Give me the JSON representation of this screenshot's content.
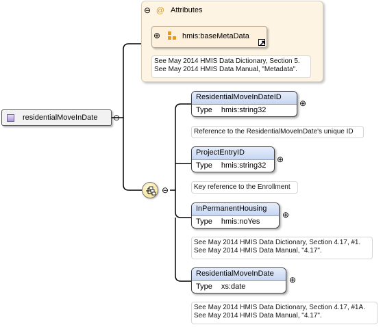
{
  "root": {
    "name": "residentialMoveInDate",
    "collapse_symbol": "⊖"
  },
  "attributes": {
    "title": "Attributes",
    "at_symbol": "@",
    "collapse_symbol": "⊖",
    "ref": {
      "name": "hmis:baseMetaData",
      "expand_symbol": "⊕"
    },
    "doc_lines": [
      "See May 2014 HMIS Data Dictionary, Section 5.",
      "See May 2014 HMIS Data Manual, \"Metadata\"."
    ]
  },
  "sequence": {
    "collapse_symbol": "⊖"
  },
  "elements": [
    {
      "name": "ResidentialMoveInDateID",
      "type_label": "Type",
      "type": "hmis:string32",
      "expand_symbol": "⊕",
      "doc": [
        "Reference to the ResidentialMoveInDate's unique ID"
      ]
    },
    {
      "name": "ProjectEntryID",
      "type_label": "Type",
      "type": "hmis:string32",
      "expand_symbol": "⊕",
      "doc": [
        "Key reference to the Enrollment"
      ]
    },
    {
      "name": "InPermanentHousing",
      "type_label": "Type",
      "type": "hmis:noYes",
      "expand_symbol": "⊕",
      "doc": [
        "See May 2014 HMIS Data Dictionary, Section 4.17, #1.",
        "See May 2014 HMIS Data Manual, \"4.17\"."
      ]
    },
    {
      "name": "ResidentialMoveInDate",
      "type_label": "Type",
      "type": "xs:date",
      "expand_symbol": "⊕",
      "doc": [
        "See May 2014 HMIS Data Dictionary, Section 4.17, #1A.",
        "See May 2014 HMIS Data Manual, \"4.17\"."
      ]
    }
  ]
}
